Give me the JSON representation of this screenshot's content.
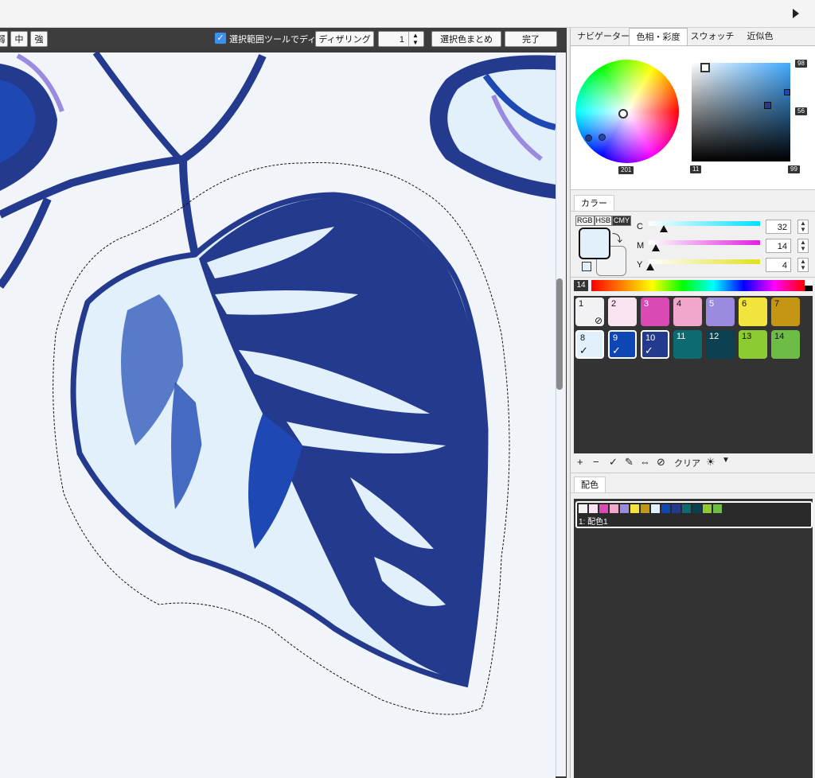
{
  "toolbar": {
    "buttons": [
      "弱",
      "中",
      "強"
    ],
    "checkbox_label": "選択範囲ツールでディザ",
    "checkbox_checked": true,
    "dither_label": "ディザリング",
    "spin_value": "1",
    "merge_label": "選択色まとめ",
    "done_label": "完了"
  },
  "right_panel": {
    "tabs": [
      "ナビゲーター",
      "色相・彩度",
      "スウォッチ",
      "近似色"
    ],
    "active_tab": 1,
    "wheel_markers": {
      "sq_top_right": "98",
      "sq_right": "56",
      "sq_bottom_left": "11",
      "sq_bottom_right": "99",
      "wheel_bottom": "201"
    },
    "color_section_label": "カラー",
    "mode_buttons": [
      "RGB",
      "HSB",
      "CMY"
    ],
    "active_mode": "CMY",
    "sliders": [
      {
        "label": "C",
        "value": "32",
        "fraction": 0.13
      },
      {
        "label": "M",
        "value": "14",
        "fraction": 0.06
      },
      {
        "label": "Y",
        "value": "4",
        "fraction": 0.02
      }
    ],
    "palette_count": "14",
    "swatches": [
      {
        "num": "1",
        "color": "#f2f2f4",
        "mark": "none"
      },
      {
        "num": "2",
        "color": "#fbe4f1",
        "mark": ""
      },
      {
        "num": "3",
        "color": "#d94ab4",
        "mark": ""
      },
      {
        "num": "4",
        "color": "#f2a6cc",
        "mark": ""
      },
      {
        "num": "5",
        "color": "#9a8ae0",
        "mark": ""
      },
      {
        "num": "6",
        "color": "#f2e43c",
        "mark": ""
      },
      {
        "num": "7",
        "color": "#c49614",
        "mark": ""
      },
      {
        "num": "8",
        "color": "#e1f0fb",
        "mark": "check"
      },
      {
        "num": "9",
        "color": "#0e46b4",
        "mark": "check"
      },
      {
        "num": "10",
        "color": "#233a8e",
        "mark": "check"
      },
      {
        "num": "11",
        "color": "#0d6a70",
        "mark": ""
      },
      {
        "num": "12",
        "color": "#0b4050",
        "mark": ""
      },
      {
        "num": "13",
        "color": "#8ccc32",
        "mark": ""
      },
      {
        "num": "14",
        "color": "#6cbc46",
        "mark": ""
      }
    ],
    "swatch_tools": {
      "clear_label": "クリア"
    },
    "haishoku_label": "配色",
    "scheme_name": "1: 配色1"
  },
  "colors": {
    "bg_canvas": "#f1f5fa",
    "light": "#e1f0fb",
    "mid": "#1e48b3",
    "dark": "#233a8e",
    "accent_purple": "#9a8ae0"
  }
}
